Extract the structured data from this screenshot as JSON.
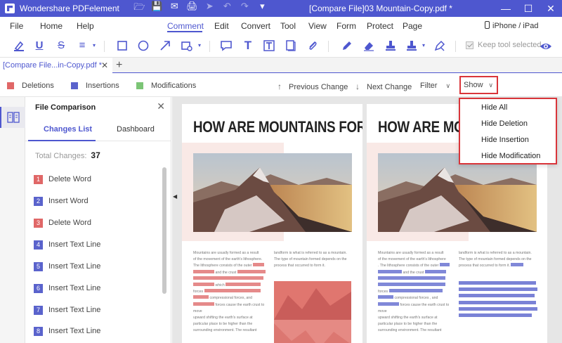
{
  "app": {
    "name": "Wondershare PDFelement",
    "document_title": "[Compare File]03 Mountain-Copy.pdf *"
  },
  "menu": {
    "items": [
      "File",
      "Home",
      "Help",
      "Comment",
      "Edit",
      "Convert",
      "Tool",
      "View",
      "Form",
      "Protect",
      "Page"
    ],
    "active": "Comment",
    "device_label": "iPhone / iPad"
  },
  "toolbar": {
    "tools": [
      "highlight-icon",
      "underline-icon",
      "strikethrough-icon",
      "lines-icon",
      "rectangle-icon",
      "circle-icon",
      "arrow-icon",
      "shape-icon",
      "note-icon",
      "text-icon",
      "textbox-icon",
      "sticky-icon",
      "attachment-icon",
      "pencil-icon",
      "eraser-icon",
      "stamp-icon",
      "signature-icon",
      "hand-sign-icon"
    ],
    "keep_tool_label": "Keep tool selected",
    "keep_tool_checked": true
  },
  "tabs": [
    {
      "label": "[Compare  File...in-Copy.pdf *"
    }
  ],
  "legend": {
    "deletions": "Deletions",
    "insertions": "Insertions",
    "modifications": "Modifications",
    "previous_change": "Previous Change",
    "next_change": "Next Change",
    "filter": "Filter",
    "show": "Show",
    "colors": {
      "deletion": "#e06767",
      "insertion": "#5a63cc",
      "modification": "#7cc576"
    }
  },
  "show_menu": {
    "options": [
      "Hide All",
      "Hide Deletion",
      "Hide Insertion",
      "Hide Modification"
    ]
  },
  "panel": {
    "title": "File Comparison",
    "tabs": [
      "Changes List",
      "Dashboard"
    ],
    "active_tab": "Changes List",
    "total_label": "Total Changes:",
    "total_value": "37",
    "changes": [
      {
        "num": "1",
        "type": "deletion",
        "label": "Delete Word"
      },
      {
        "num": "2",
        "type": "insertion",
        "label": "Insert Word"
      },
      {
        "num": "3",
        "type": "deletion",
        "label": "Delete Word"
      },
      {
        "num": "4",
        "type": "insertion",
        "label": "Insert Text Line"
      },
      {
        "num": "5",
        "type": "insertion",
        "label": "Insert Text Line"
      },
      {
        "num": "6",
        "type": "insertion",
        "label": "Insert Text Line"
      },
      {
        "num": "7",
        "type": "insertion",
        "label": "Insert Text Line"
      },
      {
        "num": "8",
        "type": "insertion",
        "label": "Insert Text Line"
      }
    ]
  },
  "document": {
    "left_heading": "HOW ARE MOUNTAINS FORMED?",
    "right_heading": "HOW ARE MOUNTAI",
    "left_col_1": [
      "Mountains are usually formed as a result",
      "of the movement of the earth's lithosphere.",
      "The lithosphere consists of the outer",
      "and the crust",
      "which",
      "forces",
      "compressional forces, and",
      "forces cause the earth crust to move",
      "upward shifting the earth's surface at",
      "particular place to be higher than the",
      "surrounding environment. The resultant"
    ],
    "left_col_2": [
      "landform is what is referred to as a mountain.",
      "The type of mountain formed depends on the",
      "process that occurred to form it."
    ],
    "right_col_1": [
      "Mountains are usually formed as a result",
      "of the movement of the earth's lithosphere",
      ". The lithosphere consists of the outer",
      "and the crust",
      "forces",
      "compressional forces , and",
      "forces cause the earth crust to move",
      "upward shifting the earth's surface at",
      "particular place to be higher than the",
      "surrounding environment. The resultant"
    ],
    "right_col_2": [
      "landform is what is referred to as a mountain.",
      "The type of mountain formed depends on the",
      "process that occurred to form it."
    ]
  }
}
